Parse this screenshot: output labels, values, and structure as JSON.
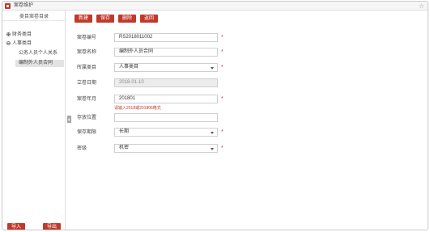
{
  "window": {
    "title": "案卷维护"
  },
  "sidebar": {
    "header": "类目案卷目录",
    "tree": {
      "finance": "财务类目",
      "personnel": "人事类目",
      "child_1": "公务人员个人关系",
      "child_2": "编制外人员合同"
    },
    "import_label": "导入",
    "export_label": "导出"
  },
  "toolbar": {
    "new_label": "新建",
    "save_label": "保存",
    "delete_label": "删除",
    "back_label": "返回"
  },
  "form": {
    "file_no": {
      "label": "案卷编号",
      "value": "RS2018011002"
    },
    "file_name": {
      "label": "案卷名称",
      "value": "编制外人员合同"
    },
    "category": {
      "label": "所属类目",
      "value": "人事类目"
    },
    "created_date": {
      "label": "立卷日期",
      "value": "2018-01-10"
    },
    "year_month": {
      "label": "案卷年月",
      "value": "201801",
      "hint": "请输入2018或201806格式"
    },
    "location": {
      "label": "存放位置",
      "value": ""
    },
    "retention": {
      "label": "保存期限",
      "value": "长期"
    },
    "secrecy": {
      "label": "密级",
      "value": "机密"
    },
    "required_mark": "*"
  },
  "colors": {
    "accent": "#c0392b",
    "disabled_bg": "#ececec",
    "border": "#cfcfcf"
  }
}
